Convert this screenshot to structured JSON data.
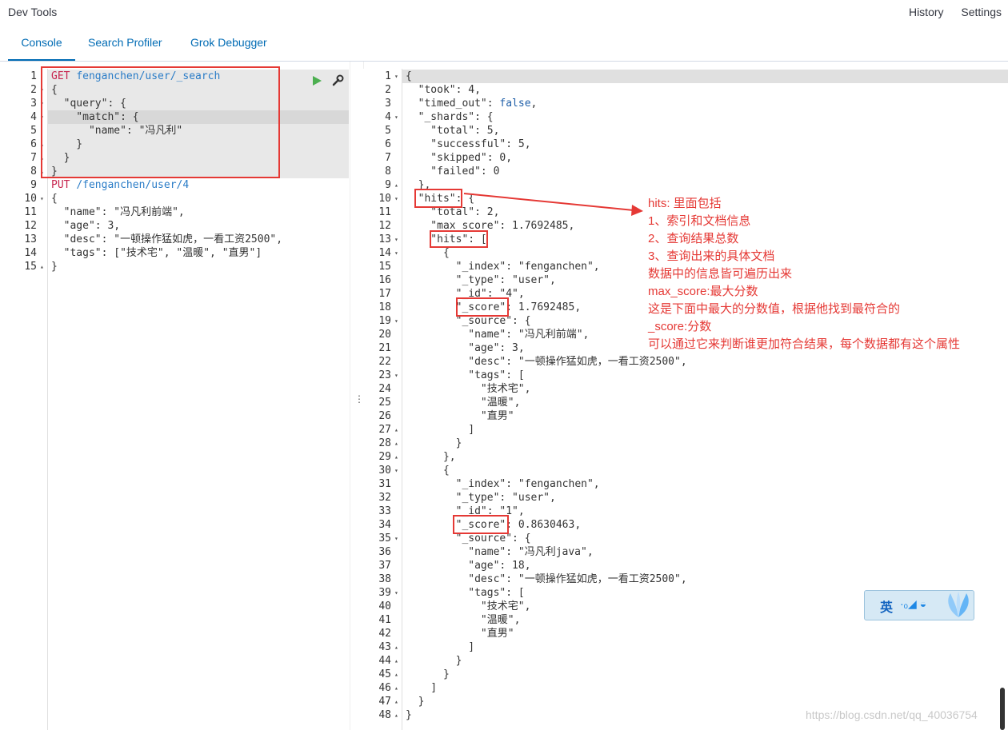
{
  "header": {
    "app_title": "Dev Tools",
    "links": [
      "History",
      "Settings"
    ]
  },
  "tabs": [
    "Console",
    "Search Profiler",
    "Grok Debugger"
  ],
  "input_editor": {
    "lines": [
      {
        "n": "1",
        "fold": "",
        "segs": [
          [
            "method",
            "GET "
          ],
          [
            "url",
            "fenganchen/user/_search"
          ]
        ]
      },
      {
        "n": "2",
        "fold": "▾",
        "segs": [
          [
            "k",
            "{"
          ]
        ]
      },
      {
        "n": "3",
        "fold": "▾",
        "segs": [
          [
            "k",
            "  \"query\": {"
          ]
        ]
      },
      {
        "n": "4",
        "fold": "▾",
        "segs": [
          [
            "k",
            "    \"match\": {"
          ]
        ]
      },
      {
        "n": "5",
        "fold": "",
        "segs": [
          [
            "k",
            "      \"name\": \"冯凡利\""
          ]
        ]
      },
      {
        "n": "6",
        "fold": "▴",
        "segs": [
          [
            "k",
            "    }"
          ]
        ]
      },
      {
        "n": "7",
        "fold": "▴",
        "segs": [
          [
            "k",
            "  }"
          ]
        ]
      },
      {
        "n": "8",
        "fold": "▴",
        "segs": [
          [
            "k",
            "}"
          ]
        ]
      },
      {
        "n": "9",
        "fold": "",
        "segs": [
          [
            "method",
            "PUT "
          ],
          [
            "url",
            "/fenganchen/user/4"
          ]
        ]
      },
      {
        "n": "10",
        "fold": "▾",
        "segs": [
          [
            "k",
            "{"
          ]
        ]
      },
      {
        "n": "11",
        "fold": "",
        "segs": [
          [
            "k",
            "  \"name\": \"冯凡利前端\","
          ]
        ]
      },
      {
        "n": "12",
        "fold": "",
        "segs": [
          [
            "k",
            "  \"age\": 3,"
          ]
        ]
      },
      {
        "n": "13",
        "fold": "",
        "segs": [
          [
            "k",
            "  \"desc\": \"一顿操作猛如虎，一看工资2500\","
          ]
        ]
      },
      {
        "n": "14",
        "fold": "",
        "segs": [
          [
            "k",
            "  \"tags\": [\"技术宅\", \"温暖\", \"直男\"]"
          ]
        ]
      },
      {
        "n": "15",
        "fold": "▴",
        "segs": [
          [
            "k",
            "}"
          ]
        ]
      }
    ]
  },
  "output_editor": {
    "lines": [
      {
        "n": "1",
        "fold": "▾",
        "segs": [
          [
            "k",
            "{"
          ]
        ]
      },
      {
        "n": "2",
        "fold": "",
        "segs": [
          [
            "k",
            "  \"took\": 4,"
          ]
        ]
      },
      {
        "n": "3",
        "fold": "",
        "segs": [
          [
            "k",
            "  \"timed_out\": "
          ],
          [
            "bool",
            "false"
          ],
          [
            "k",
            ","
          ]
        ]
      },
      {
        "n": "4",
        "fold": "▾",
        "segs": [
          [
            "k",
            "  \"_shards\": {"
          ]
        ]
      },
      {
        "n": "5",
        "fold": "",
        "segs": [
          [
            "k",
            "    \"total\": 5,"
          ]
        ]
      },
      {
        "n": "6",
        "fold": "",
        "segs": [
          [
            "k",
            "    \"successful\": 5,"
          ]
        ]
      },
      {
        "n": "7",
        "fold": "",
        "segs": [
          [
            "k",
            "    \"skipped\": 0,"
          ]
        ]
      },
      {
        "n": "8",
        "fold": "",
        "segs": [
          [
            "k",
            "    \"failed\": 0"
          ]
        ]
      },
      {
        "n": "9",
        "fold": "▴",
        "segs": [
          [
            "k",
            "  },"
          ]
        ]
      },
      {
        "n": "10",
        "fold": "▾",
        "segs": [
          [
            "k",
            "  \"hits\": {"
          ]
        ]
      },
      {
        "n": "11",
        "fold": "",
        "segs": [
          [
            "k",
            "    \"total\": 2,"
          ]
        ]
      },
      {
        "n": "12",
        "fold": "",
        "segs": [
          [
            "k",
            "    \"max_score\": 1.7692485,"
          ]
        ]
      },
      {
        "n": "13",
        "fold": "▾",
        "segs": [
          [
            "k",
            "    \"hits\": ["
          ]
        ]
      },
      {
        "n": "14",
        "fold": "▾",
        "segs": [
          [
            "k",
            "      {"
          ]
        ]
      },
      {
        "n": "15",
        "fold": "",
        "segs": [
          [
            "k",
            "        \"_index\": \"fenganchen\","
          ]
        ]
      },
      {
        "n": "16",
        "fold": "",
        "segs": [
          [
            "k",
            "        \"_type\": \"user\","
          ]
        ]
      },
      {
        "n": "17",
        "fold": "",
        "segs": [
          [
            "k",
            "        \"_id\": \"4\","
          ]
        ]
      },
      {
        "n": "18",
        "fold": "",
        "segs": [
          [
            "k",
            "        \"_score\": 1.7692485,"
          ]
        ]
      },
      {
        "n": "19",
        "fold": "▾",
        "segs": [
          [
            "k",
            "        \"_source\": {"
          ]
        ]
      },
      {
        "n": "20",
        "fold": "",
        "segs": [
          [
            "k",
            "          \"name\": \"冯凡利前端\","
          ]
        ]
      },
      {
        "n": "21",
        "fold": "",
        "segs": [
          [
            "k",
            "          \"age\": 3,"
          ]
        ]
      },
      {
        "n": "22",
        "fold": "",
        "segs": [
          [
            "k",
            "          \"desc\": \"一顿操作猛如虎，一看工资2500\","
          ]
        ]
      },
      {
        "n": "23",
        "fold": "▾",
        "segs": [
          [
            "k",
            "          \"tags\": ["
          ]
        ]
      },
      {
        "n": "24",
        "fold": "",
        "segs": [
          [
            "k",
            "            \"技术宅\","
          ]
        ]
      },
      {
        "n": "25",
        "fold": "",
        "segs": [
          [
            "k",
            "            \"温暖\","
          ]
        ]
      },
      {
        "n": "26",
        "fold": "",
        "segs": [
          [
            "k",
            "            \"直男\""
          ]
        ]
      },
      {
        "n": "27",
        "fold": "▴",
        "segs": [
          [
            "k",
            "          ]"
          ]
        ]
      },
      {
        "n": "28",
        "fold": "▴",
        "segs": [
          [
            "k",
            "        }"
          ]
        ]
      },
      {
        "n": "29",
        "fold": "▴",
        "segs": [
          [
            "k",
            "      },"
          ]
        ]
      },
      {
        "n": "30",
        "fold": "▾",
        "segs": [
          [
            "k",
            "      {"
          ]
        ]
      },
      {
        "n": "31",
        "fold": "",
        "segs": [
          [
            "k",
            "        \"_index\": \"fenganchen\","
          ]
        ]
      },
      {
        "n": "32",
        "fold": "",
        "segs": [
          [
            "k",
            "        \"_type\": \"user\","
          ]
        ]
      },
      {
        "n": "33",
        "fold": "",
        "segs": [
          [
            "k",
            "        \"_id\": \"1\","
          ]
        ]
      },
      {
        "n": "34",
        "fold": "",
        "segs": [
          [
            "k",
            "        \"_score\": 0.8630463,"
          ]
        ]
      },
      {
        "n": "35",
        "fold": "▾",
        "segs": [
          [
            "k",
            "        \"_source\": {"
          ]
        ]
      },
      {
        "n": "36",
        "fold": "",
        "segs": [
          [
            "k",
            "          \"name\": \"冯凡利java\","
          ]
        ]
      },
      {
        "n": "37",
        "fold": "",
        "segs": [
          [
            "k",
            "          \"age\": 18,"
          ]
        ]
      },
      {
        "n": "38",
        "fold": "",
        "segs": [
          [
            "k",
            "          \"desc\": \"一顿操作猛如虎，一看工资2500\","
          ]
        ]
      },
      {
        "n": "39",
        "fold": "▾",
        "segs": [
          [
            "k",
            "          \"tags\": ["
          ]
        ]
      },
      {
        "n": "40",
        "fold": "",
        "segs": [
          [
            "k",
            "            \"技术宅\","
          ]
        ]
      },
      {
        "n": "41",
        "fold": "",
        "segs": [
          [
            "k",
            "            \"温暖\","
          ]
        ]
      },
      {
        "n": "42",
        "fold": "",
        "segs": [
          [
            "k",
            "            \"直男\""
          ]
        ]
      },
      {
        "n": "43",
        "fold": "▴",
        "segs": [
          [
            "k",
            "          ]"
          ]
        ]
      },
      {
        "n": "44",
        "fold": "▴",
        "segs": [
          [
            "k",
            "        }"
          ]
        ]
      },
      {
        "n": "45",
        "fold": "▴",
        "segs": [
          [
            "k",
            "      }"
          ]
        ]
      },
      {
        "n": "46",
        "fold": "▴",
        "segs": [
          [
            "k",
            "    ]"
          ]
        ]
      },
      {
        "n": "47",
        "fold": "▴",
        "segs": [
          [
            "k",
            "  }"
          ]
        ]
      },
      {
        "n": "48",
        "fold": "▴",
        "segs": [
          [
            "k",
            "}"
          ]
        ]
      }
    ]
  },
  "annotation": [
    "hits: 里面包括",
    "1、索引和文档信息",
    "2、查询结果总数",
    "3、查询出来的具体文档",
    "数据中的信息皆可遍历出来",
    "max_score:最大分数",
    "这是下面中最大的分数值，根据他找到最符合的",
    "_score:分数",
    "可以通过它来判断谁更加符合结果，每个数据都有这个属性"
  ],
  "ime": {
    "char": "英",
    "icons": "·ₒ◢ ◒"
  },
  "watermark": "https://blog.csdn.net/qq_40036754",
  "colors": {
    "accent": "#006bb4",
    "annotation": "#e53935",
    "method": "#c7254e",
    "url": "#2a7cc7"
  }
}
